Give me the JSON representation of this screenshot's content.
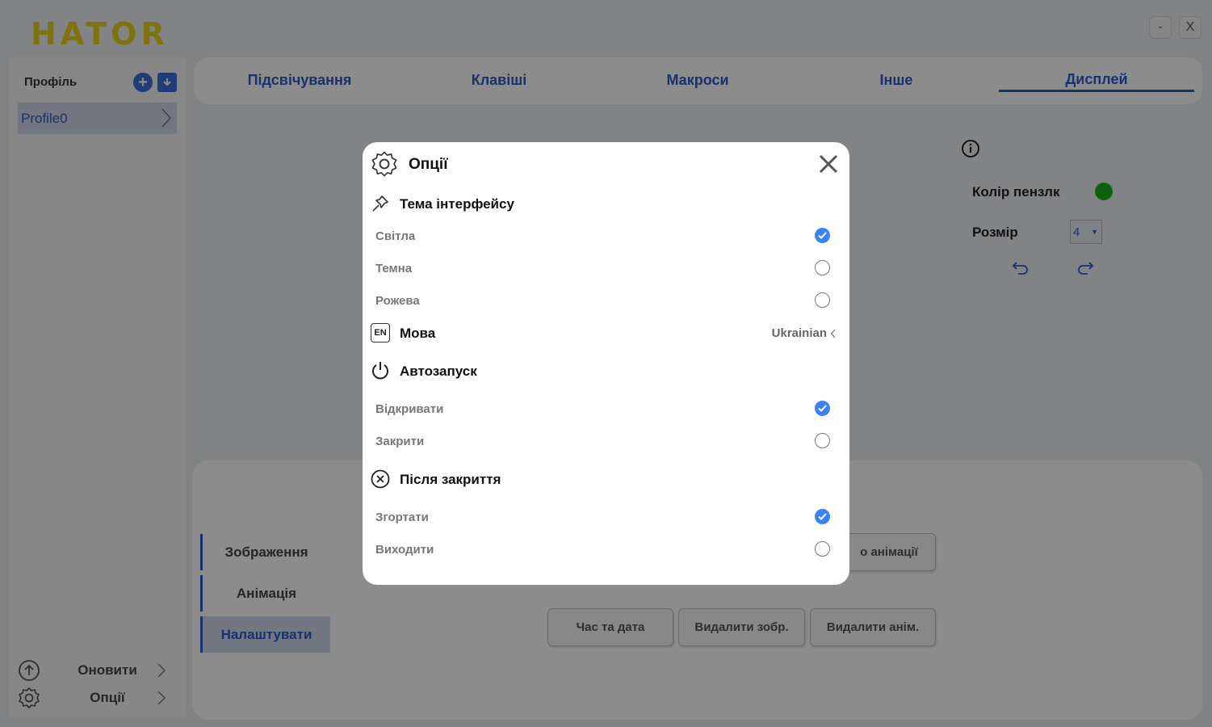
{
  "app": {
    "logo": "HATOR",
    "window_controls": {
      "minimize": "-",
      "close": "X"
    }
  },
  "sidebar": {
    "title": "Профіль",
    "profiles": [
      "Profile0"
    ],
    "bottom": {
      "update_label": "Оновити",
      "options_label": "Опції"
    }
  },
  "tabs": [
    {
      "label": "Підсвічування",
      "active": false
    },
    {
      "label": "Клавіші",
      "active": false
    },
    {
      "label": "Макроси",
      "active": false
    },
    {
      "label": "Інше",
      "active": false
    },
    {
      "label": "Дисплей",
      "active": true
    }
  ],
  "display_panel": {
    "brush_color_label": "Колір пензлк",
    "brush_color": "#1ab31a",
    "size_label": "Розмір",
    "size_value": "4"
  },
  "lower_panel": {
    "side_tabs": [
      {
        "label": "Зображення",
        "active": false
      },
      {
        "label": "Анімація",
        "active": false
      },
      {
        "label": "Налаштувати",
        "active": true
      }
    ],
    "buttons": {
      "animation_partial": "о анімації",
      "time_date": "Час та дата",
      "delete_image": "Видалити зобр.",
      "delete_animation": "Видалити анім."
    }
  },
  "modal": {
    "title": "Опції",
    "theme": {
      "title": "Тема інтерфейсу",
      "options": [
        {
          "label": "Світла",
          "checked": true
        },
        {
          "label": "Темна",
          "checked": false
        },
        {
          "label": "Рожева",
          "checked": false
        }
      ]
    },
    "language": {
      "icon_text": "EN",
      "title": "Мова",
      "value": "Ukrainian"
    },
    "autostart": {
      "title": "Автозапуск",
      "options": [
        {
          "label": "Відкривати",
          "checked": true
        },
        {
          "label": "Закрити",
          "checked": false
        }
      ]
    },
    "after_close": {
      "title": "Після закриття",
      "options": [
        {
          "label": "Згортати",
          "checked": true
        },
        {
          "label": "Виходити",
          "checked": false
        }
      ]
    }
  },
  "colors": {
    "accent": "#2c5cc5",
    "checked": "#3b82f6",
    "logo": "#e6d21a"
  }
}
